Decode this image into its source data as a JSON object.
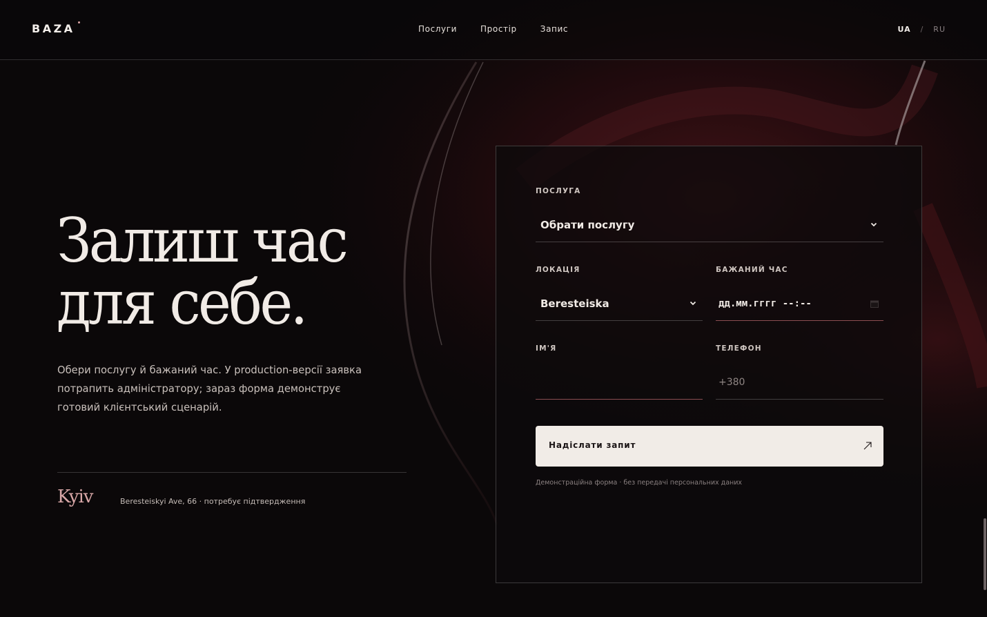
{
  "brand": {
    "logo": "BAZA"
  },
  "nav": {
    "items": [
      "Послуги",
      "Простір",
      "Запис"
    ]
  },
  "lang": {
    "active": "UA",
    "separator": "/",
    "inactive": "RU"
  },
  "hero": {
    "title_line1": "Залиш час",
    "title_line2": "для себе.",
    "description": "Обери послугу й бажаний час. У production-версії заявка потрапить адміністратору; зараз форма демонструє готовий клієнтський сценарій.",
    "city": "Kyiv",
    "address": "Beresteiskyi Ave, 66 · потребує підтвердження"
  },
  "form": {
    "service": {
      "label": "ПОСЛУГА",
      "value": "Обрати послугу"
    },
    "location": {
      "label": "ЛОКАЦІЯ",
      "value": "Beresteiska"
    },
    "time": {
      "label": "БАЖАНИЙ ЧАС",
      "value": "дд.мм.гггг --:--"
    },
    "name": {
      "label": "ІМ'Я",
      "value": ""
    },
    "phone": {
      "label": "ТЕЛЕФОН",
      "placeholder": "+380"
    },
    "submit_label": "Надіслати запит",
    "note": "Демонстраційна форма · без передачі персональних даних"
  },
  "colors": {
    "accent": "#d8a7a7",
    "background": "#0b0809",
    "button": "#f1ece7"
  },
  "icons": {
    "select": "chevron-down-icon",
    "date": "calendar-icon",
    "submit": "arrow-up-right-icon"
  }
}
